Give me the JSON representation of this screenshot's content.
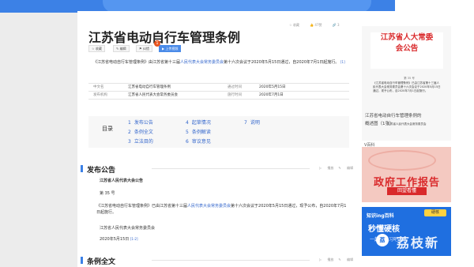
{
  "title": "江苏省电动自行车管理条例",
  "toolbar": {
    "collect": "收藏",
    "like": "47赞",
    "share_count": "3",
    "share": "",
    "collect_btn": "收藏",
    "edit_btn": "编辑",
    "error_btn": "纠错",
    "upload_btn": "上传视频",
    "badge": "1"
  },
  "intro": {
    "text_a": "《江苏省电动自行车管理条例》由江苏省第十三届",
    "link": "人民代表大会常务委员会",
    "text_b": "第十六次会议于2020年5月15日通过，自2020年7月1日起施行。",
    "ref": "[1]"
  },
  "info": {
    "name_label": "中文名",
    "name_value": "江苏省电动自行车管理条例",
    "pass_label": "通过时间",
    "pass_value": "2020年5月15日",
    "pub_label": "发布机构",
    "pub_value": "江苏省人民代表大会常务委员会",
    "impl_label": "施行时间",
    "impl_value": "2020年7月1日"
  },
  "toc": {
    "label": "目录",
    "items": [
      {
        "num": "1",
        "text": "发布公告"
      },
      {
        "num": "2",
        "text": "条例全文"
      },
      {
        "num": "3",
        "text": "立法目的"
      },
      {
        "num": "4",
        "text": "起草情况"
      },
      {
        "num": "5",
        "text": "条例解读"
      },
      {
        "num": "6",
        "text": "审议意见"
      },
      {
        "num": "7",
        "text": "说明"
      }
    ]
  },
  "section1": {
    "title": "发布公告",
    "tool_play": "播放",
    "tool_edit": "编辑",
    "heading": "江苏省人民代表大会公告",
    "no": "第 35 号",
    "text_a": "《江苏省电动自行车管理条例》已由江苏省第十三届",
    "link": "人民代表大会常务委员会",
    "text_b": "第十六次会议于2020年5月15日通过，现予公布，自2020年7月1日起施行。",
    "sign": "江苏省人民代表大会常务委员会",
    "date": "2020年5月15日",
    "ref": "[1-2]"
  },
  "section2": {
    "title": "条例全文",
    "tool_play": "播放",
    "tool_edit": "编辑"
  },
  "sidecard": {
    "title_line1": "江苏省人大常委",
    "title_line2": "会公告",
    "no": "第 35 号",
    "body": "《江苏省电动自行车管理条例》已由江苏省第十三届人民代表大会常务委员会第十六次会议于2020年5月15日通过，现予公布，自2020年7月1日起施行。",
    "sign": "江苏省人民代表大会常务委员会",
    "caption1": "江苏省电动自行车管理条例的",
    "caption2": "概述图（1张）"
  },
  "side": {
    "vbaike": "V百科",
    "promo1_title": "政府工作报告",
    "promo1_tag": "回望看懂",
    "promo2_top": "知识ing百科",
    "promo2_tag": "硬核",
    "promo2_title": "秒懂硬核",
    "promo2_sub": "一起来学习吧",
    "watermark_icon": "荔",
    "watermark": "荔枝新"
  },
  "colors": {
    "accent": "#3c81e6",
    "link": "#3366cc",
    "red": "#d9292b"
  }
}
